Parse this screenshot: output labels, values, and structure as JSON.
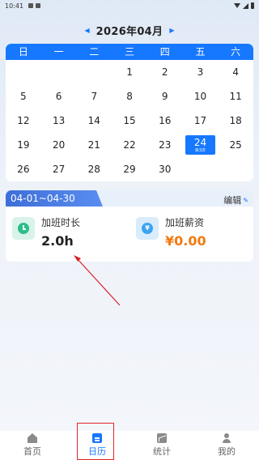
{
  "status_bar": {
    "time": "10:41"
  },
  "month_nav": {
    "prev_icon": "◀",
    "title": "2026年04月",
    "next_icon": "▶"
  },
  "calendar": {
    "weekdays": [
      "日",
      "一",
      "二",
      "三",
      "四",
      "五",
      "六"
    ],
    "weeks": [
      [
        "",
        "",
        "",
        "1",
        "2",
        "3",
        "4"
      ],
      [
        "5",
        "6",
        "7",
        "8",
        "9",
        "10",
        "11"
      ],
      [
        "12",
        "13",
        "14",
        "15",
        "16",
        "17",
        "18"
      ],
      [
        "19",
        "20",
        "21",
        "22",
        "23",
        "24",
        "25"
      ],
      [
        "26",
        "27",
        "28",
        "29",
        "30",
        "",
        ""
      ]
    ],
    "selected_day": "24",
    "selected_sub": "余3次"
  },
  "summary": {
    "date_range": "04-01~04-30",
    "edit_label": "编辑",
    "overtime_label": "加班时长",
    "overtime_value": "2.0h",
    "pay_label": "加班薪资",
    "pay_value": "¥0.00",
    "pay_icon": "¥"
  },
  "tab_bar": {
    "home": "首页",
    "calendar": "日历",
    "stats": "统计",
    "mine": "我的"
  },
  "colors": {
    "accent": "#1677ff",
    "money": "#f07a10",
    "highlight": "#e0262d"
  }
}
